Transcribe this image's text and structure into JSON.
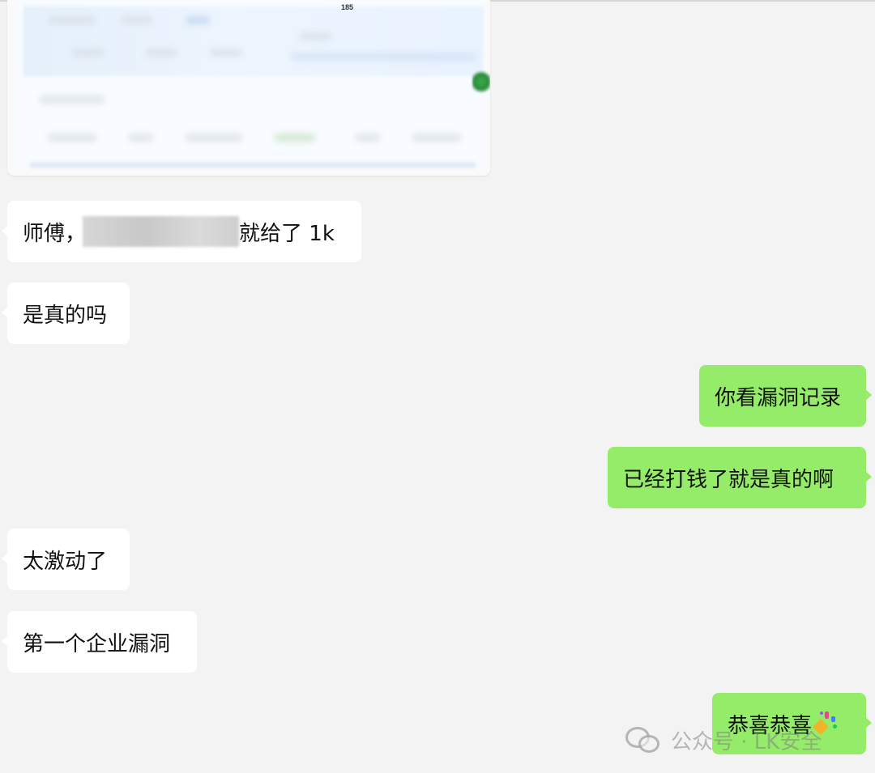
{
  "chat": {
    "messages": [
      {
        "side": "left",
        "text_before": "师傅，",
        "text_after": "就给了 1k"
      },
      {
        "side": "left",
        "text": "是真的吗"
      },
      {
        "side": "right",
        "text": "你看漏洞记录"
      },
      {
        "side": "right",
        "text": "已经打钱了就是真的啊"
      },
      {
        "side": "left",
        "text": "太激动了"
      },
      {
        "side": "left",
        "text": "第一个企业漏洞"
      },
      {
        "side": "right",
        "text": "恭喜恭喜"
      }
    ],
    "image_card": {
      "blurred_number": "185"
    }
  },
  "watermark": {
    "text": "公众号 · LK安全"
  },
  "colors": {
    "background": "#f3f3f3",
    "bubble_left": "#ffffff",
    "bubble_right": "#95ec69"
  },
  "icons": {
    "watermark_icon": "wechat-logo-icon",
    "confetti_icon": "party-popper-icon"
  }
}
